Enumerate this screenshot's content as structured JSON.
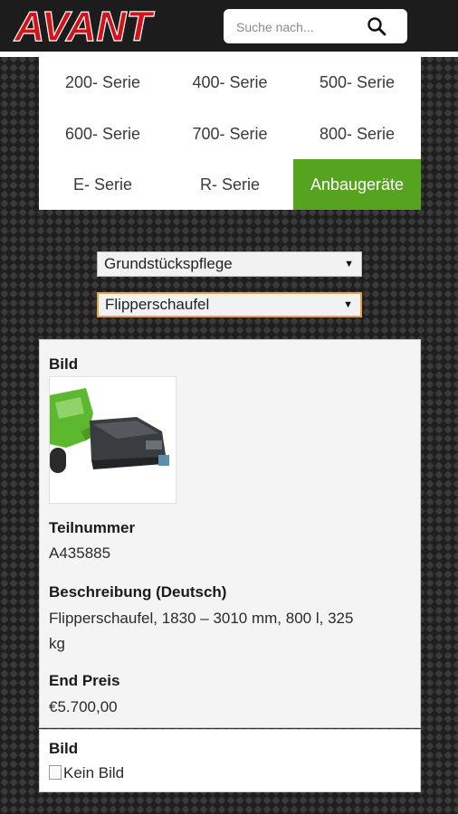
{
  "header": {
    "logo_text": "AVANT",
    "search": {
      "placeholder": "Suche nach..."
    }
  },
  "nav": {
    "items": [
      {
        "label": "200- Serie"
      },
      {
        "label": "400- Serie"
      },
      {
        "label": "500- Serie"
      },
      {
        "label": "600- Serie"
      },
      {
        "label": "700- Serie"
      },
      {
        "label": "800- Serie"
      },
      {
        "label": "E- Serie"
      },
      {
        "label": "R- Serie"
      },
      {
        "label": "Anbaugeräte",
        "active": true
      }
    ]
  },
  "filters": {
    "category": "Grundstückspflege",
    "product": "Flipperschaufel"
  },
  "products": [
    {
      "image_label": "Bild",
      "part_label": "Teilnummer",
      "part_number": "A435885",
      "desc_label": "Beschreibung (Deutsch)",
      "desc_line1": "Flipperschaufel, 1830 – 3010 mm, 800 l, 325",
      "desc_line2": "kg",
      "price_label": "End Preis",
      "price": "€5.700,00"
    },
    {
      "image_label": "Bild",
      "no_image_text": "Kein Bild"
    }
  ],
  "colors": {
    "accent_green": "#55a31f",
    "logo_red": "#d4121a",
    "select_focus": "#e3a34a"
  }
}
